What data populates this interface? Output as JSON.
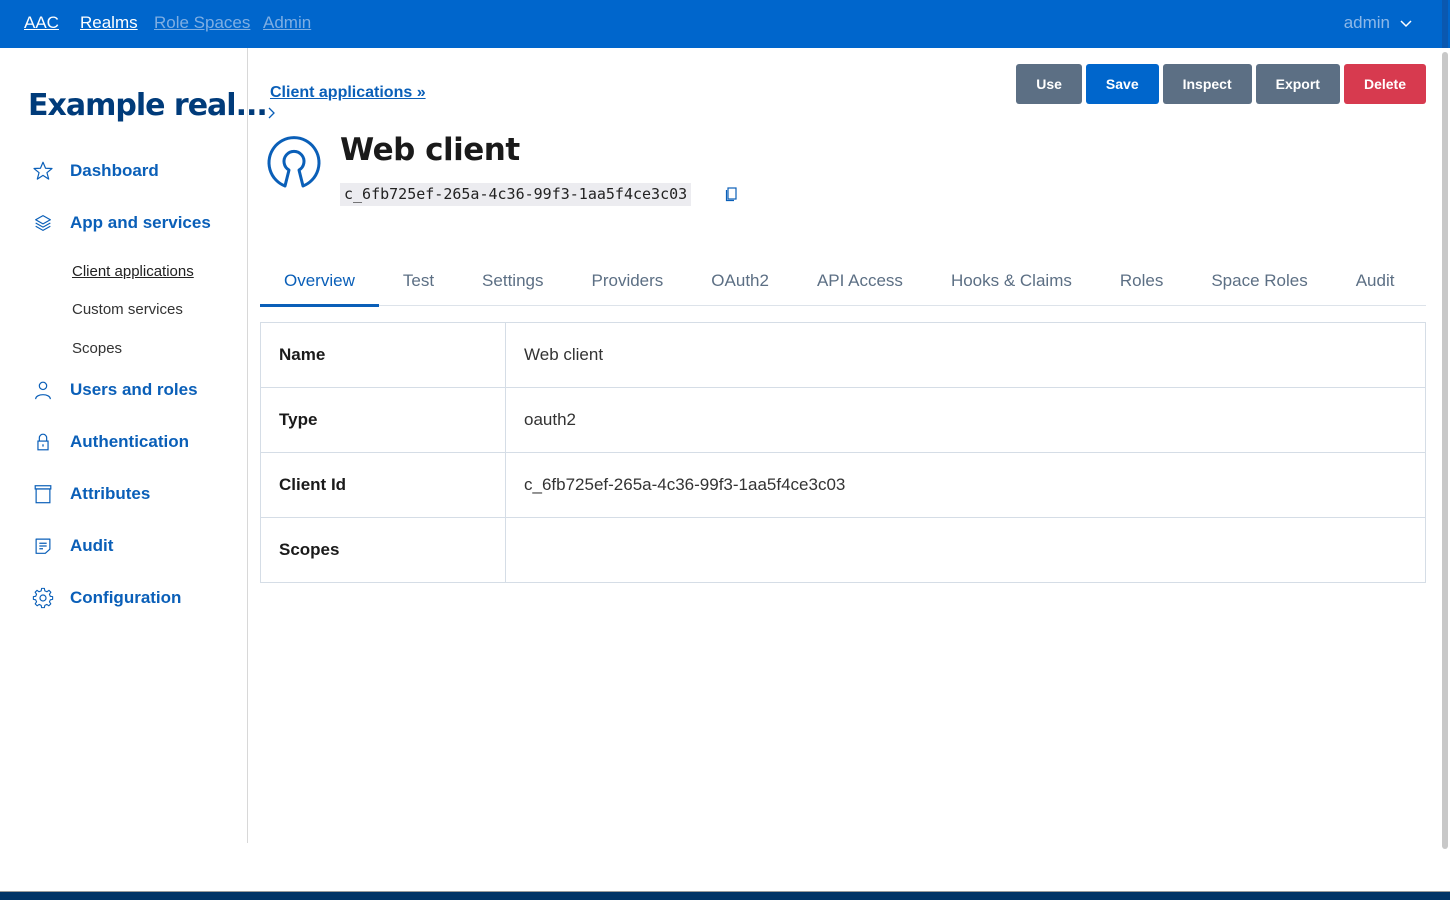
{
  "topbar": {
    "brand": "AAC",
    "nav": [
      {
        "label": "Realms",
        "active": true
      },
      {
        "label": "Role Spaces",
        "active": false
      },
      {
        "label": "Admin",
        "active": false
      }
    ],
    "user": "admin"
  },
  "sidebar": {
    "realm_title": "Example real...",
    "items": [
      {
        "label": "Dashboard",
        "icon": "star-icon"
      },
      {
        "label": "App and services",
        "icon": "layers-icon"
      },
      {
        "label": "Users and roles",
        "icon": "user-icon"
      },
      {
        "label": "Authentication",
        "icon": "lock-icon"
      },
      {
        "label": "Attributes",
        "icon": "archive-icon"
      },
      {
        "label": "Audit",
        "icon": "note-icon"
      },
      {
        "label": "Configuration",
        "icon": "gear-icon"
      }
    ],
    "subitems": [
      {
        "label": "Client applications",
        "active": true
      },
      {
        "label": "Custom services",
        "active": false
      },
      {
        "label": "Scopes",
        "active": false
      }
    ]
  },
  "main": {
    "breadcrumb": "Client applications »",
    "title": "Web client",
    "client_id": "c_6fb725ef-265a-4c36-99f3-1aa5f4ce3c03",
    "actions": {
      "use": "Use",
      "save": "Save",
      "inspect": "Inspect",
      "export": "Export",
      "delete": "Delete"
    },
    "tabs": [
      {
        "label": "Overview",
        "active": true
      },
      {
        "label": "Test"
      },
      {
        "label": "Settings"
      },
      {
        "label": "Providers"
      },
      {
        "label": "OAuth2"
      },
      {
        "label": "API Access"
      },
      {
        "label": "Hooks & Claims"
      },
      {
        "label": "Roles"
      },
      {
        "label": "Space Roles"
      },
      {
        "label": "Audit"
      }
    ],
    "details": [
      {
        "key": "Name",
        "value": "Web client"
      },
      {
        "key": "Type",
        "value": "oauth2"
      },
      {
        "key": "Client Id",
        "value": "c_6fb725ef-265a-4c36-99f3-1aa5f4ce3c03"
      },
      {
        "key": "Scopes",
        "value": ""
      }
    ]
  },
  "colors": {
    "brand": "#0066cc",
    "link": "#0a5fb8",
    "danger": "#d73a4f",
    "secondary": "#5c6f84",
    "realm_title": "#003b7a"
  }
}
